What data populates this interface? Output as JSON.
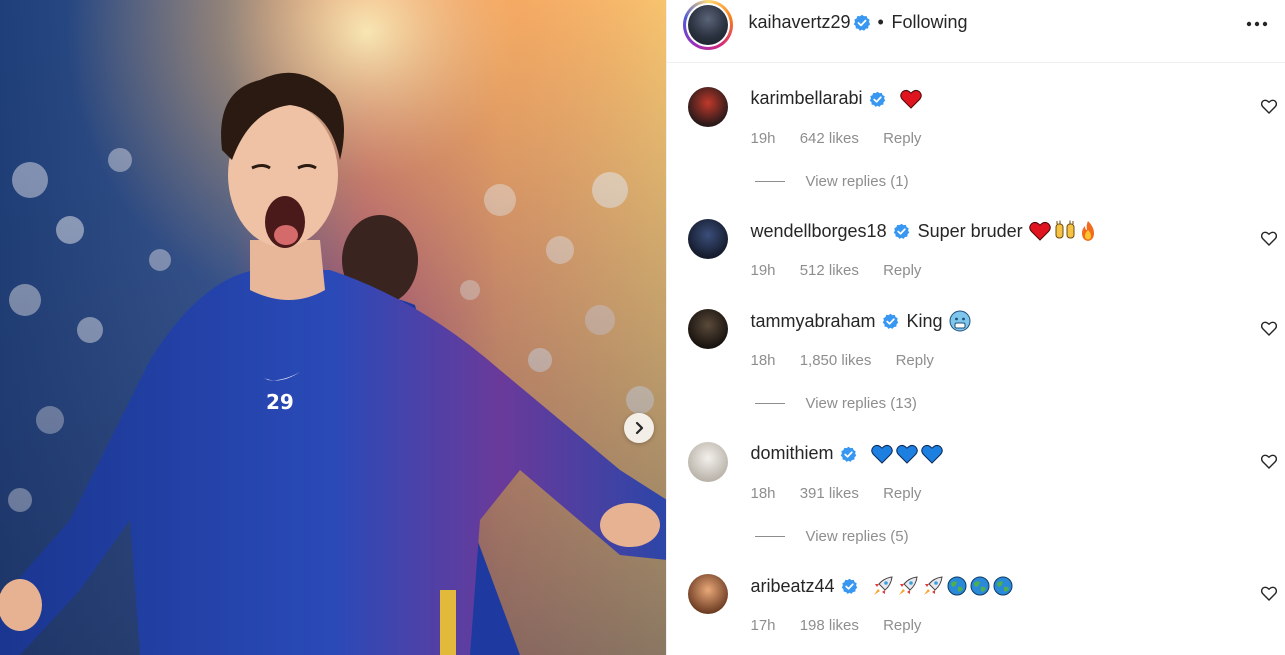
{
  "post": {
    "author": "kaihavertz29",
    "separator": "•",
    "follow_status": "Following",
    "jersey_number": "29"
  },
  "comments": [
    {
      "username": "karimbellarabi",
      "text": "",
      "emojis": [
        "red-heart"
      ],
      "time": "19h",
      "likes": "642 likes",
      "reply": "Reply",
      "view_replies": "View replies (1)"
    },
    {
      "username": "wendellborges18",
      "text": "Super bruder",
      "emojis": [
        "red-heart",
        "raising-hands",
        "fire"
      ],
      "time": "19h",
      "likes": "512 likes",
      "reply": "Reply",
      "view_replies": ""
    },
    {
      "username": "tammyabraham",
      "text": "King",
      "emojis": [
        "cold-face"
      ],
      "time": "18h",
      "likes": "1,850 likes",
      "reply": "Reply",
      "view_replies": "View replies (13)"
    },
    {
      "username": "domithiem",
      "text": "",
      "emojis": [
        "blue-heart",
        "blue-heart",
        "blue-heart"
      ],
      "time": "18h",
      "likes": "391 likes",
      "reply": "Reply",
      "view_replies": "View replies (5)"
    },
    {
      "username": "aribeatz44",
      "text": "",
      "emojis": [
        "rocket",
        "rocket",
        "rocket",
        "globe",
        "globe",
        "globe"
      ],
      "time": "17h",
      "likes": "198 likes",
      "reply": "Reply",
      "view_replies": ""
    }
  ],
  "colors": {
    "text": "#262626",
    "secondary": "#8e8e8e",
    "verified": "#3897f0",
    "jersey": "#1f3fa8"
  }
}
